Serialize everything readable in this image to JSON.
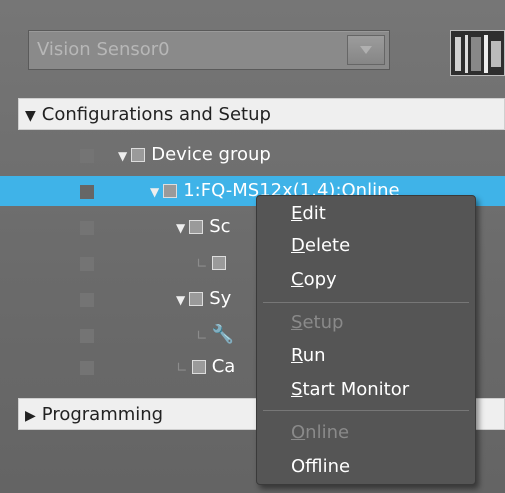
{
  "device_selector": {
    "value": "Vision Sensor0"
  },
  "sections": {
    "config_label": "Configurations and Setup",
    "prog_label": "Programming"
  },
  "tree": [
    {
      "id": "device-group",
      "label": "Device group"
    },
    {
      "id": "sensor",
      "label": "1:FQ-MS12x(1.4):Online"
    },
    {
      "id": "sc",
      "label": "Sc"
    },
    {
      "id": "sy",
      "label": "Sy"
    },
    {
      "id": "ca",
      "label": "Ca"
    }
  ],
  "context_menu": {
    "items": [
      {
        "label": "Edit",
        "mnemonic": "E",
        "rest": "dit",
        "enabled": true
      },
      {
        "label": "Delete",
        "mnemonic": "D",
        "rest": "elete",
        "enabled": true
      },
      {
        "label": "Copy",
        "mnemonic": "C",
        "rest": "opy",
        "enabled": true
      },
      {
        "label": "Setup",
        "mnemonic": "S",
        "rest": "etup",
        "enabled": false
      },
      {
        "label": "Run",
        "mnemonic": "R",
        "rest": "un",
        "enabled": true
      },
      {
        "label": "Start Monitor",
        "mnemonic": "S",
        "rest": "tart Monitor",
        "enabled": true
      },
      {
        "label": "Online",
        "mnemonic": "O",
        "rest": "nline",
        "enabled": false
      },
      {
        "label": "Offline",
        "pre": "Off",
        "mnemonic": "l",
        "rest": "ine",
        "enabled": true
      }
    ]
  },
  "colors": {
    "selection": "#3fb3e8",
    "background": "#6b6b6b"
  }
}
